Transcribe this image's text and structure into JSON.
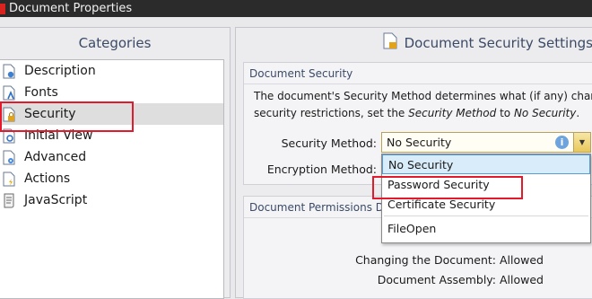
{
  "window": {
    "title": "Document Properties"
  },
  "left": {
    "heading": "Categories",
    "items": [
      {
        "label": "Description",
        "icon": "document-info-icon"
      },
      {
        "label": "Fonts",
        "icon": "document-font-icon"
      },
      {
        "label": "Security",
        "icon": "document-lock-icon",
        "selected": true
      },
      {
        "label": "Initial View",
        "icon": "document-magnify-icon"
      },
      {
        "label": "Advanced",
        "icon": "document-gear-icon"
      },
      {
        "label": "Actions",
        "icon": "document-lightning-icon"
      },
      {
        "label": "JavaScript",
        "icon": "script-scroll-icon"
      }
    ]
  },
  "right": {
    "heading": "Document Security Settings",
    "security_group": {
      "title": "Document Security",
      "desc_line1": "The document's Security Method determines what (if any) changes",
      "desc_line2_a": "security restrictions, set the ",
      "desc_line2_em1": "Security Method",
      "desc_line2_b": " to ",
      "desc_line2_em2": "No Security",
      "desc_line2_c": "."
    },
    "security_method_label": "Security Method:",
    "security_method_value": "No Security",
    "encryption_method_label": "Encryption Method:",
    "dropdown_options": [
      "No Security",
      "Password Security",
      "Certificate Security",
      "FileOpen"
    ],
    "permissions_group": {
      "title": "Document Permissions Details"
    },
    "permissions": [
      {
        "label": "Changing the Document:",
        "value": "Allowed"
      },
      {
        "label": "Document Assembly:",
        "value": "Allowed"
      }
    ]
  },
  "colors": {
    "annotation_red": "#e21a2c",
    "accent_title": "#3b4a66"
  }
}
